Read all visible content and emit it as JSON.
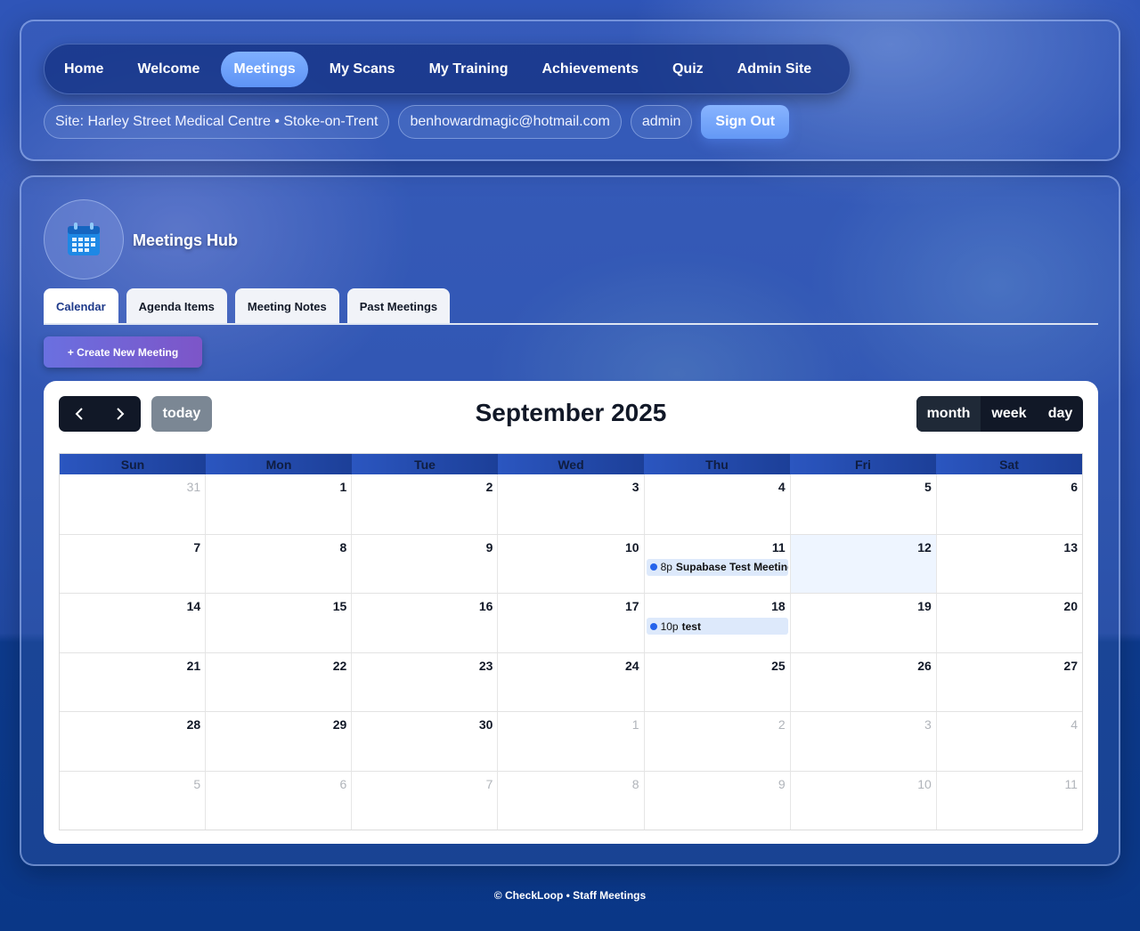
{
  "nav": {
    "items": [
      {
        "label": "Home",
        "active": false
      },
      {
        "label": "Welcome",
        "active": false
      },
      {
        "label": "Meetings",
        "active": true
      },
      {
        "label": "My Scans",
        "active": false
      },
      {
        "label": "My Training",
        "active": false
      },
      {
        "label": "Achievements",
        "active": false
      },
      {
        "label": "Quiz",
        "active": false
      },
      {
        "label": "Admin Site",
        "active": false
      }
    ]
  },
  "user_bar": {
    "site": "Site: Harley Street Medical Centre • Stoke-on-Trent",
    "email": "benhowardmagic@hotmail.com",
    "role": "admin",
    "sign_out": "Sign Out"
  },
  "hub": {
    "icon": "calendar-icon",
    "title": "Meetings Hub",
    "tabs": [
      {
        "label": "Calendar",
        "active": true
      },
      {
        "label": "Agenda Items",
        "active": false
      },
      {
        "label": "Meeting Notes",
        "active": false
      },
      {
        "label": "Past Meetings",
        "active": false
      }
    ],
    "create_button": "+ Create New Meeting"
  },
  "calendar": {
    "title": "September 2025",
    "today_label": "today",
    "views": [
      {
        "label": "month",
        "active": true
      },
      {
        "label": "week",
        "active": false
      },
      {
        "label": "day",
        "active": false
      }
    ],
    "weekdays": [
      "Sun",
      "Mon",
      "Tue",
      "Wed",
      "Thu",
      "Fri",
      "Sat"
    ],
    "weeks": [
      [
        {
          "n": "31",
          "other": true
        },
        {
          "n": "1"
        },
        {
          "n": "2"
        },
        {
          "n": "3"
        },
        {
          "n": "4"
        },
        {
          "n": "5"
        },
        {
          "n": "6"
        }
      ],
      [
        {
          "n": "7"
        },
        {
          "n": "8"
        },
        {
          "n": "9"
        },
        {
          "n": "10"
        },
        {
          "n": "11",
          "event": {
            "time": "8p",
            "title": "Supabase Test Meeting"
          }
        },
        {
          "n": "12",
          "today": true
        },
        {
          "n": "13"
        }
      ],
      [
        {
          "n": "14"
        },
        {
          "n": "15"
        },
        {
          "n": "16"
        },
        {
          "n": "17"
        },
        {
          "n": "18",
          "event": {
            "time": "10p",
            "title": "test"
          }
        },
        {
          "n": "19"
        },
        {
          "n": "20"
        }
      ],
      [
        {
          "n": "21"
        },
        {
          "n": "22"
        },
        {
          "n": "23"
        },
        {
          "n": "24"
        },
        {
          "n": "25"
        },
        {
          "n": "26"
        },
        {
          "n": "27"
        }
      ],
      [
        {
          "n": "28"
        },
        {
          "n": "29"
        },
        {
          "n": "30"
        },
        {
          "n": "1",
          "other": true
        },
        {
          "n": "2",
          "other": true
        },
        {
          "n": "3",
          "other": true
        },
        {
          "n": "4",
          "other": true
        }
      ],
      [
        {
          "n": "5",
          "other": true
        },
        {
          "n": "6",
          "other": true
        },
        {
          "n": "7",
          "other": true
        },
        {
          "n": "8",
          "other": true
        },
        {
          "n": "9",
          "other": true
        },
        {
          "n": "10",
          "other": true
        },
        {
          "n": "11",
          "other": true
        }
      ]
    ]
  },
  "footer": {
    "text": "© CheckLoop • Staff Meetings"
  }
}
